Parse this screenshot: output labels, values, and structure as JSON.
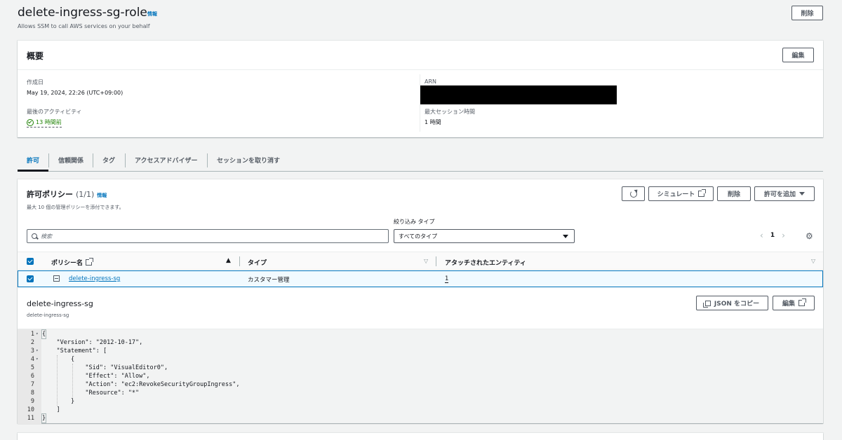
{
  "header": {
    "title": "delete-ingress-sg-role",
    "info_link": "情報",
    "subtitle": "Allows SSM to call AWS services on your behalf",
    "delete_button": "削除"
  },
  "summary": {
    "title": "概要",
    "edit_button": "編集",
    "created_label": "作成日",
    "created_value": "May 19, 2024, 22:26 (UTC+09:00)",
    "last_activity_label": "最後のアクティビティ",
    "last_activity_value": "13 時間前",
    "arn_label": "ARN",
    "max_session_label": "最大セッション時間",
    "max_session_value": "1 時間"
  },
  "tabs": [
    "許可",
    "信頼関係",
    "タグ",
    "アクセスアドバイザー",
    "セッションを取り消す"
  ],
  "policies": {
    "title": "許可ポリシー",
    "count": "(1/1)",
    "info_link": "情報",
    "description": "最大 10 個の管理ポリシーを添付できます。",
    "simulate_button": "シミュレート",
    "delete_button": "削除",
    "add_button": "許可を追加",
    "filter_type_label": "絞り込み タイプ",
    "search_placeholder": "検索",
    "filter_type_value": "すべてのタイプ",
    "page_number": "1",
    "columns": [
      "ポリシー名",
      "タイプ",
      "アタッチされたエンティティ"
    ],
    "rows": [
      {
        "name": "delete-ingress-sg",
        "type": "カスタマー管理",
        "entities": "1"
      }
    ]
  },
  "detail": {
    "title": "delete-ingress-sg",
    "subtitle": "delete-ingress-sg",
    "copy_json_button": "JSON をコピー",
    "edit_button": "編集",
    "code_lines": [
      "{",
      "    \"Version\": \"2012-10-17\",",
      "    \"Statement\": [",
      "        {",
      "            \"Sid\": \"VisualEditor0\",",
      "            \"Effect\": \"Allow\",",
      "            \"Action\": \"ec2:RevokeSecurityGroupIngress\",",
      "            \"Resource\": \"*\"",
      "        }",
      "    ]",
      "}"
    ]
  },
  "colors": {
    "accent": "#0073bb",
    "success": "#1d8102",
    "link": "#0073bb"
  }
}
